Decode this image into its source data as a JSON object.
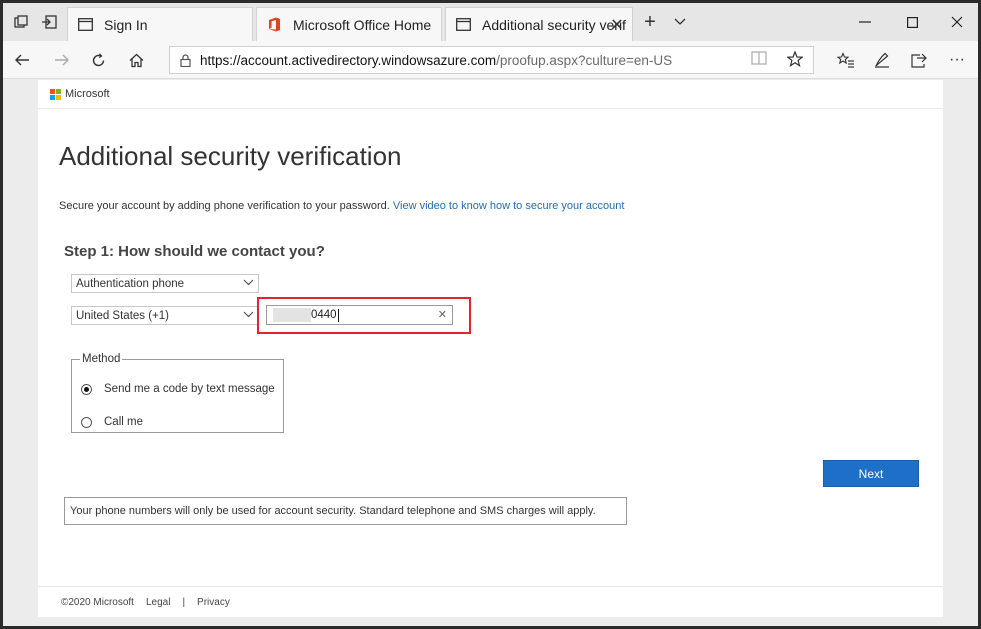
{
  "browser": {
    "tabs": [
      {
        "title": "Sign In"
      },
      {
        "title": "Microsoft Office Home"
      },
      {
        "title": "Additional security verif"
      }
    ],
    "url_host": "https://account.activedirectory.windowsazure.com",
    "url_path": "/proofup.aspx?culture=en-US"
  },
  "page": {
    "brand": "Microsoft",
    "title": "Additional security verification",
    "description": "Secure your account by adding phone verification to your password.",
    "video_link": "View video to know how to secure your account",
    "step_title": "Step 1: How should we contact you?",
    "contact_method": "Authentication phone",
    "country": "United States (+1)",
    "phone_value": "0440",
    "method_legend": "Method",
    "method_options": [
      {
        "label": "Send me a code by text message",
        "selected": true
      },
      {
        "label": "Call me",
        "selected": false
      }
    ],
    "next_label": "Next",
    "note": "Your phone numbers will only be used for account security. Standard telephone and SMS charges will apply.",
    "footer": {
      "copyright": "©2020 Microsoft",
      "legal": "Legal",
      "separator": "|",
      "privacy": "Privacy"
    }
  },
  "colors": {
    "accent": "#1e6fc7",
    "highlight": "#e0252e",
    "link": "#1f6fb5"
  }
}
